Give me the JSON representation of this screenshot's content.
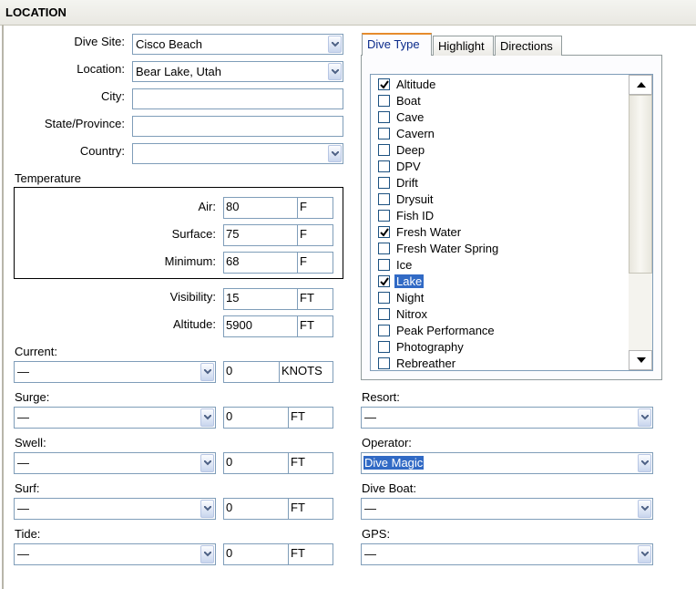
{
  "section_title": "LOCATION",
  "dive_site": {
    "label": "Dive Site:",
    "value": "Cisco Beach"
  },
  "location": {
    "label": "Location:",
    "value": "Bear Lake, Utah"
  },
  "city": {
    "label": "City:",
    "value": ""
  },
  "state": {
    "label": "State/Province:",
    "value": ""
  },
  "country": {
    "label": "Country:",
    "value": ""
  },
  "temperature": {
    "label": "Temperature",
    "air": {
      "label": "Air:",
      "value": "80",
      "unit": "F"
    },
    "surface": {
      "label": "Surface:",
      "value": "75",
      "unit": "F"
    },
    "minimum": {
      "label": "Minimum:",
      "value": "68",
      "unit": "F"
    }
  },
  "visibility": {
    "label": "Visibility:",
    "value": "15",
    "unit": "FT"
  },
  "altitude": {
    "label": "Altitude:",
    "value": "5900",
    "unit": "FT"
  },
  "current": {
    "label": "Current:",
    "select": "—",
    "value": "0",
    "unit": "KNOTS"
  },
  "surge": {
    "label": "Surge:",
    "select": "—",
    "value": "0",
    "unit": "FT"
  },
  "swell": {
    "label": "Swell:",
    "select": "—",
    "value": "0",
    "unit": "FT"
  },
  "surf": {
    "label": "Surf:",
    "select": "—",
    "value": "0",
    "unit": "FT"
  },
  "tide": {
    "label": "Tide:",
    "select": "—",
    "value": "0",
    "unit": "FT"
  },
  "tabs": [
    {
      "label": "Dive Type",
      "active": true
    },
    {
      "label": "Highlight",
      "active": false
    },
    {
      "label": "Directions",
      "active": false
    }
  ],
  "dive_types": [
    {
      "label": "Altitude",
      "checked": true,
      "selected": false
    },
    {
      "label": "Boat",
      "checked": false,
      "selected": false
    },
    {
      "label": "Cave",
      "checked": false,
      "selected": false
    },
    {
      "label": "Cavern",
      "checked": false,
      "selected": false
    },
    {
      "label": "Deep",
      "checked": false,
      "selected": false
    },
    {
      "label": "DPV",
      "checked": false,
      "selected": false
    },
    {
      "label": "Drift",
      "checked": false,
      "selected": false
    },
    {
      "label": "Drysuit",
      "checked": false,
      "selected": false
    },
    {
      "label": "Fish ID",
      "checked": false,
      "selected": false
    },
    {
      "label": "Fresh Water",
      "checked": true,
      "selected": false
    },
    {
      "label": "Fresh Water Spring",
      "checked": false,
      "selected": false
    },
    {
      "label": "Ice",
      "checked": false,
      "selected": false
    },
    {
      "label": "Lake",
      "checked": true,
      "selected": true
    },
    {
      "label": "Night",
      "checked": false,
      "selected": false
    },
    {
      "label": "Nitrox",
      "checked": false,
      "selected": false
    },
    {
      "label": "Peak Performance",
      "checked": false,
      "selected": false
    },
    {
      "label": "Photography",
      "checked": false,
      "selected": false
    },
    {
      "label": "Rebreather",
      "checked": false,
      "selected": false
    }
  ],
  "resort": {
    "label": "Resort:",
    "value": "—"
  },
  "operator": {
    "label": "Operator:",
    "value": "Dive Magic"
  },
  "dive_boat": {
    "label": "Dive Boat:",
    "value": "—"
  },
  "gps": {
    "label": "GPS:",
    "value": "—"
  },
  "colors": {
    "selection": "#316ac5",
    "border": "#7f9db9",
    "tab_accent": "#e68b2c"
  }
}
